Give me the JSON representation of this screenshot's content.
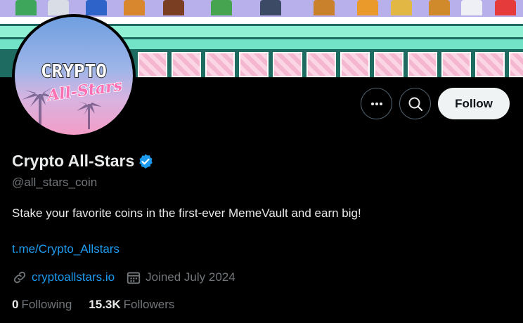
{
  "profile": {
    "display_name": "Crypto All-Stars",
    "handle": "@all_stars_coin",
    "bio": "Stake your favorite coins in the first-ever MemeVault and earn big!",
    "link": "t.me/Crypto_Allstars",
    "website": "cryptoallstars.io",
    "joined": "Joined July 2024",
    "following_count": "0",
    "following_label": "Following",
    "followers_count": "15.3K",
    "followers_label": "Followers",
    "avatar_text_top": "CRYPTO",
    "avatar_text_bottom": "All-Stars"
  },
  "actions": {
    "follow_label": "Follow",
    "more_icon": "more-icon",
    "search_icon": "search-icon"
  },
  "colors": {
    "background": "#000000",
    "link": "#1d9bf0",
    "muted": "#71767b",
    "verified": "#1d9bf0",
    "follow_bg": "#eff3f4"
  }
}
